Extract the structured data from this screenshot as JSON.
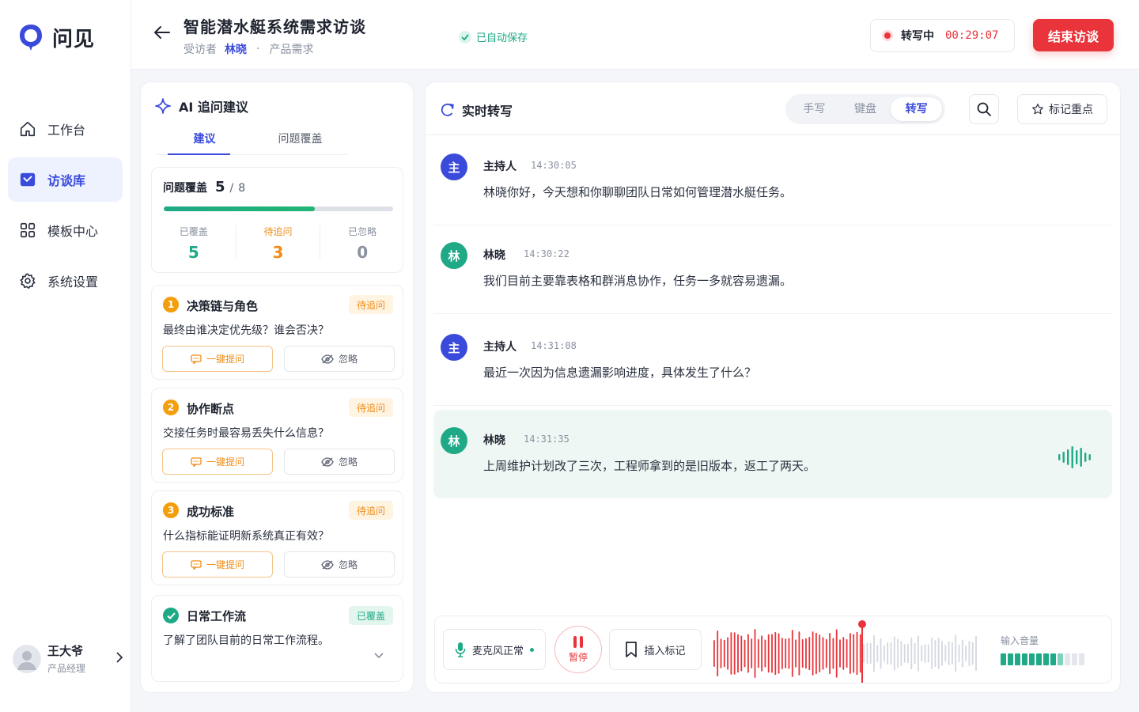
{
  "app": {
    "name": "问见",
    "brand_color": "#3A4BDB"
  },
  "sidebar": {
    "items": [
      {
        "label": "工作台",
        "icon": "home-icon",
        "active": false
      },
      {
        "label": "访谈库",
        "icon": "interview-library-icon",
        "active": true
      },
      {
        "label": "模板中心",
        "icon": "grid-icon",
        "active": false
      },
      {
        "label": "系统设置",
        "icon": "gear-icon",
        "active": false
      }
    ],
    "user": {
      "name": "王大爷",
      "role": "产品经理"
    }
  },
  "header": {
    "title": "智能潜水艇系统需求访谈",
    "interviewee_label": "受访者",
    "interviewee_name": "林晓",
    "separator": "·",
    "category": "产品需求",
    "saved_text": "已自动保存",
    "recording_label": "转写中",
    "recording_time": "00:29:07",
    "end_button": "结束访谈"
  },
  "left": {
    "title": "AI 追问建议",
    "tabs": [
      "建议",
      "问题覆盖"
    ],
    "coverage": {
      "label": "问题覆盖",
      "covered": "5",
      "separator": "/",
      "total": "8",
      "progress": 0.66,
      "stats": [
        {
          "label": "已覆盖",
          "value": "5",
          "color": "#1FA987"
        },
        {
          "label": "待追问",
          "value": "3",
          "color": "#F08C16"
        },
        {
          "label": "已忽略",
          "value": "0",
          "color": "#8A91A0"
        }
      ]
    },
    "questions": [
      {
        "num": "1",
        "title": "决策链与角色",
        "badge": "待追问",
        "text": "最终由谁决定优先级？谁会否决？",
        "ask": "一键提问",
        "ignore": "忽略"
      },
      {
        "num": "2",
        "title": "协作断点",
        "badge": "待追问",
        "text": "交接任务时最容易丢失什么信息？",
        "ask": "一键提问",
        "ignore": "忽略"
      },
      {
        "num": "3",
        "title": "成功标准",
        "badge": "待追问",
        "text": "什么指标能证明新系统真正有效？",
        "ask": "一键提问",
        "ignore": "忽略"
      }
    ],
    "done": {
      "title": "日常工作流",
      "badge": "已覆盖",
      "text": "了解了团队目前的日常工作流程。"
    }
  },
  "transcript": {
    "title": "实时转写",
    "modes": [
      "手写",
      "键盘",
      "转写"
    ],
    "active_mode": 2,
    "mark_button": "标记重点",
    "messages": [
      {
        "avatar": "主",
        "role": "host",
        "name": "主持人",
        "time": "14:30:05",
        "text": "林晓你好，今天想和你聊聊团队日常如何管理潜水艇任务。"
      },
      {
        "avatar": "林",
        "role": "guest",
        "name": "林晓",
        "time": "14:30:22",
        "text": "我们目前主要靠表格和群消息协作，任务一多就容易遗漏。"
      },
      {
        "avatar": "主",
        "role": "host",
        "name": "主持人",
        "time": "14:31:08",
        "text": "最近一次因为信息遗漏影响进度，具体发生了什么？"
      },
      {
        "avatar": "林",
        "role": "guest",
        "name": "林晓",
        "time": "14:31:35",
        "text": "上周维护计划改了三次，工程师拿到的是旧版本，返工了两天。"
      }
    ],
    "controls": {
      "mic_label": "麦克风正常",
      "pause_label": "暂停",
      "insert_label": "插入标记",
      "volume_label": "输入音量",
      "volume_level": 0.75
    }
  }
}
